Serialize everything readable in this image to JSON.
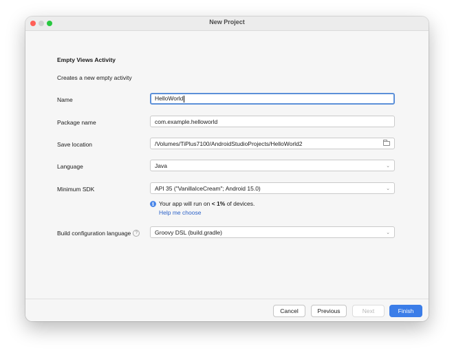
{
  "window": {
    "title": "New Project"
  },
  "heading": "Empty Views Activity",
  "description": "Creates a new empty activity",
  "form": {
    "name": {
      "label": "Name",
      "value": "HelloWorld"
    },
    "package": {
      "label": "Package name",
      "value": "com.example.helloworld"
    },
    "save_location": {
      "label": "Save location",
      "value": "/Volumes/TiPlus7100/AndroidStudioProjects/HelloWorld2"
    },
    "language": {
      "label": "Language",
      "value": "Java"
    },
    "min_sdk": {
      "label": "Minimum SDK",
      "value": "API 35 (\"VanillaIceCream\"; Android 15.0)"
    },
    "build_config": {
      "label": "Build configuration language",
      "value": "Groovy DSL (build.gradle)"
    }
  },
  "info": {
    "prefix": "Your app will run on ",
    "emphasis": "< 1%",
    "suffix": " of devices.",
    "link": "Help me choose"
  },
  "buttons": {
    "cancel": "Cancel",
    "previous": "Previous",
    "next": "Next",
    "finish": "Finish"
  },
  "colors": {
    "accent": "#3b7de8",
    "link": "#2d63c8",
    "focus": "#5b8fd8"
  }
}
